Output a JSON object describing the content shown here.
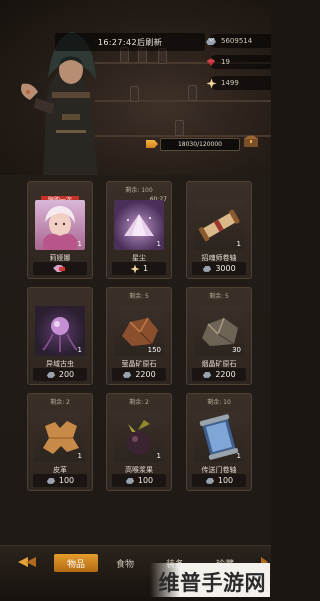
{
  "header": {
    "refresh_timer": "16:27:42后刷新"
  },
  "resources": [
    {
      "icon": "ore-icon",
      "value": "5609514"
    },
    {
      "icon": "ruby-icon",
      "value": "19"
    },
    {
      "icon": "star-shard-icon",
      "value": "1499"
    }
  ],
  "experience": {
    "text": "18030/120000",
    "progress": 0.15
  },
  "items": [
    {
      "name": "莉娅娜",
      "tag": "限购一次",
      "stock": "",
      "timer": "",
      "qty": "1",
      "price": "",
      "price_icon": "red-ticket-icon",
      "thumb": "portrait"
    },
    {
      "name": "星尘",
      "tag": "",
      "stock": "剩余: 100",
      "timer": "60:27",
      "qty": "1",
      "price": "1",
      "price_icon": "star-shard-icon",
      "thumb": "stardust"
    },
    {
      "name": "招魂师卷轴",
      "tag": "",
      "stock": "",
      "timer": "",
      "qty": "1",
      "price": "3000",
      "price_icon": "ore-icon",
      "thumb": "scroll"
    },
    {
      "name": "异域古虫",
      "tag": "",
      "stock": "",
      "timer": "",
      "qty": "1",
      "price": "200",
      "price_icon": "ore-icon",
      "thumb": "bug"
    },
    {
      "name": "萤晶矿原石",
      "tag": "",
      "stock": "剩余: 5",
      "timer": "",
      "qty": "150",
      "price": "2200",
      "price_icon": "ore-icon",
      "thumb": "orebrown"
    },
    {
      "name": "烟晶矿原石",
      "tag": "",
      "stock": "剩余: 5",
      "timer": "",
      "qty": "30",
      "price": "2200",
      "price_icon": "ore-icon",
      "thumb": "oregray"
    },
    {
      "name": "皮革",
      "tag": "",
      "stock": "剩余: 2",
      "timer": "",
      "qty": "1",
      "price": "100",
      "price_icon": "ore-icon",
      "thumb": "leather"
    },
    {
      "name": "高喉浆果",
      "tag": "",
      "stock": "剩余: 2",
      "timer": "",
      "qty": "1",
      "price": "100",
      "price_icon": "ore-icon",
      "thumb": "berry"
    },
    {
      "name": "传送门卷轴",
      "tag": "",
      "stock": "剩余: 10",
      "timer": "",
      "qty": "1",
      "price": "100",
      "price_icon": "ore-icon",
      "thumb": "portal"
    }
  ],
  "nav": {
    "tabs": [
      "物品",
      "食物",
      "装备",
      "珍藏"
    ]
  },
  "watermark": "维普手游网"
}
